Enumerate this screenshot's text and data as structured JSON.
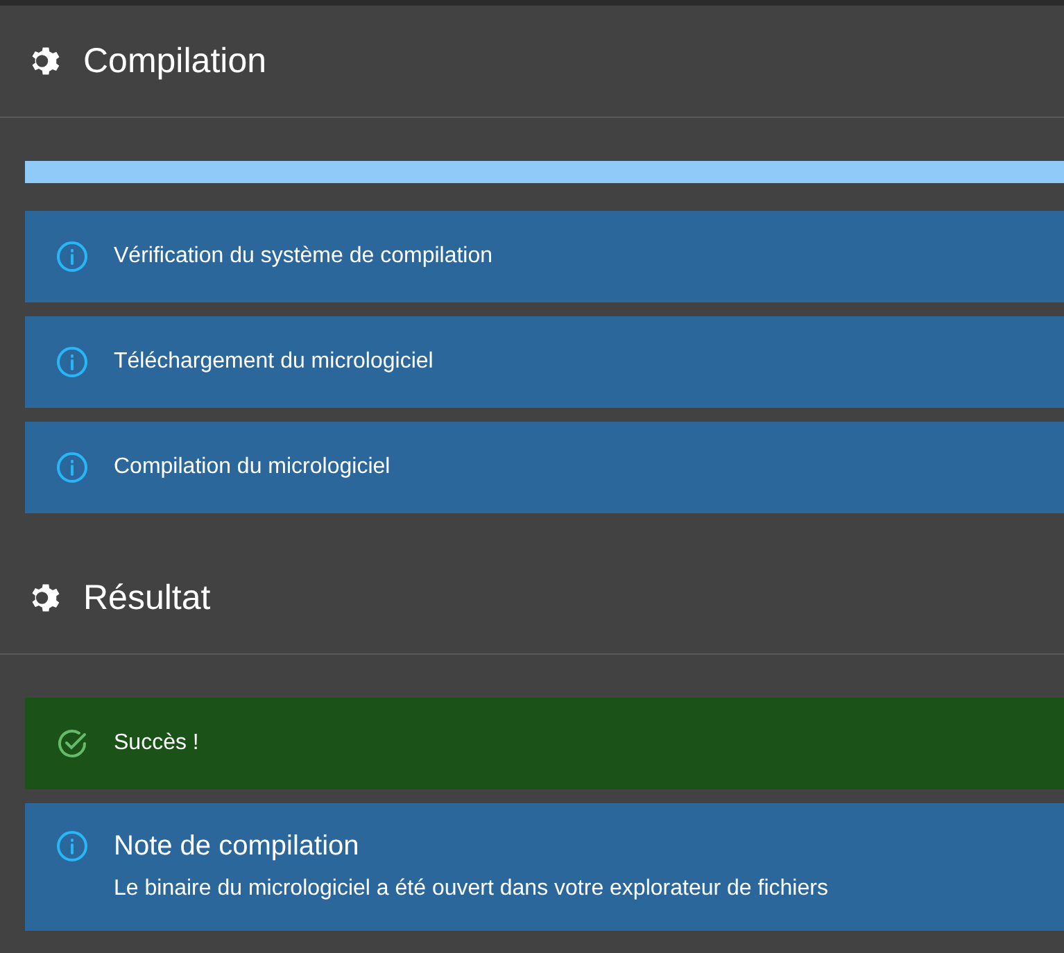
{
  "sections": [
    {
      "title": "Compilation",
      "progress": {
        "level": 1
      },
      "alerts": [
        {
          "kind": "info",
          "text": "Vérification du système de compilation"
        },
        {
          "kind": "info",
          "text": "Téléchargement du micrologiciel"
        },
        {
          "kind": "info",
          "text": "Compilation du micrologiciel"
        }
      ]
    },
    {
      "title": "Résultat",
      "alerts": [
        {
          "kind": "success",
          "text": "Succès !"
        },
        {
          "kind": "info",
          "title": "Note de compilation",
          "text": "Le binaire du micrologiciel a été ouvert dans votre explorateur de fichiers"
        }
      ]
    }
  ]
}
